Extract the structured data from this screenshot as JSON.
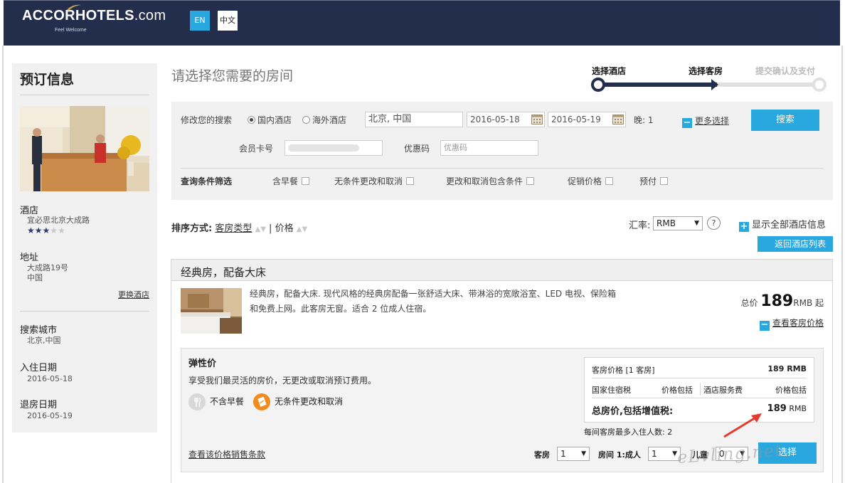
{
  "header": {
    "logo_main": "ACCORHOTELS",
    "logo_com": ".com",
    "logo_tagline": "Feel Welcome",
    "lang_en": "EN",
    "lang_zh": "中文"
  },
  "sidebar": {
    "title": "预订信息",
    "hotel_label": "酒店",
    "hotel_name": "宜必思北京大成路",
    "stars_filled": 3,
    "stars_total": 5,
    "address_label": "地址",
    "address_line1": "大成路19号",
    "address_line2": "中国",
    "change_hotel": "更换酒店",
    "city_label": "搜索城市",
    "city_value": "北京,中国",
    "checkin_label": "入住日期",
    "checkin_value": "2016-05-18",
    "checkout_label": "退房日期",
    "checkout_value": "2016-05-19"
  },
  "main": {
    "title": "请选择您需要的房间"
  },
  "steps": [
    {
      "label": "选择酒店",
      "state": "done"
    },
    {
      "label": "选择客房",
      "state": "current"
    },
    {
      "label": "提交确认及支付",
      "state": "pending"
    }
  ],
  "search": {
    "modify_label": "修改您的搜索",
    "radio_domestic": "国内酒店",
    "radio_overseas": "海外酒店",
    "destination": "北京, 中国",
    "checkin": "2016-05-18",
    "checkout": "2016-05-19",
    "nights": "晚: 1",
    "more_options": "更多选择",
    "search_button": "搜索",
    "member_card_label": "会员卡号",
    "promo_label": "优惠码",
    "promo_placeholder": "优惠码",
    "filter_label": "查询条件筛选",
    "filters": [
      "含早餐",
      "无条件更改和取消",
      "更改和取消包含条件",
      "促销价格",
      "预付"
    ]
  },
  "sort": {
    "label": "排序方式:",
    "by_room_type": "客房类型",
    "separator": "|",
    "by_price": "价格",
    "rate_label": "汇率:",
    "currency": "RMB",
    "help": "?",
    "show_all_hotel_info": "显示全部酒店信息",
    "back_to_list": "返回酒店列表"
  },
  "room": {
    "title": "经典房，配备大床",
    "description": "经典房，配备大床. 现代风格的经典房配备一张舒适大床、带淋浴的宽敞浴室、LED 电视、保险箱和免费上网。此客房无窗。适合 2 位成人住宿。",
    "price_prefix": "总价",
    "price_value": "189",
    "price_suffix": "RMB 起",
    "view_prices": "查看客房价格",
    "rate": {
      "title": "弹性价",
      "description": "享受我们最灵活的房价，无更改或取消预订费用。",
      "feature_breakfast": "不含早餐",
      "feature_cancel": "无条件更改和取消",
      "terms_link": "查看该价格销售条款",
      "price_box": {
        "room_price_label": "客房价格 [1 客房]",
        "room_price_value": "189 RMB",
        "tax_label": "国家住宿税",
        "tax_value": "价格包括",
        "service_label": "酒店服务费",
        "service_value": "价格包括",
        "total_label": "总房价,包括增值税:",
        "total_value": "189",
        "total_unit": "RMB"
      },
      "max_occupancy": "每间客房最多入住人数: 2",
      "rooms_label": "客房",
      "rooms_value": "1",
      "adults_label": "房间 1:成人",
      "adults_value": "1",
      "children_label": "儿童",
      "children_value": "0",
      "select_button": "选择"
    }
  },
  "watermark": "eLvling.net",
  "colors": {
    "navy": "#232e4d",
    "accent_blue": "#29a8e0",
    "panel_grey": "#f1f1f1",
    "arrow_red": "#e53b2c",
    "orange_icon": "#f28a1e"
  }
}
